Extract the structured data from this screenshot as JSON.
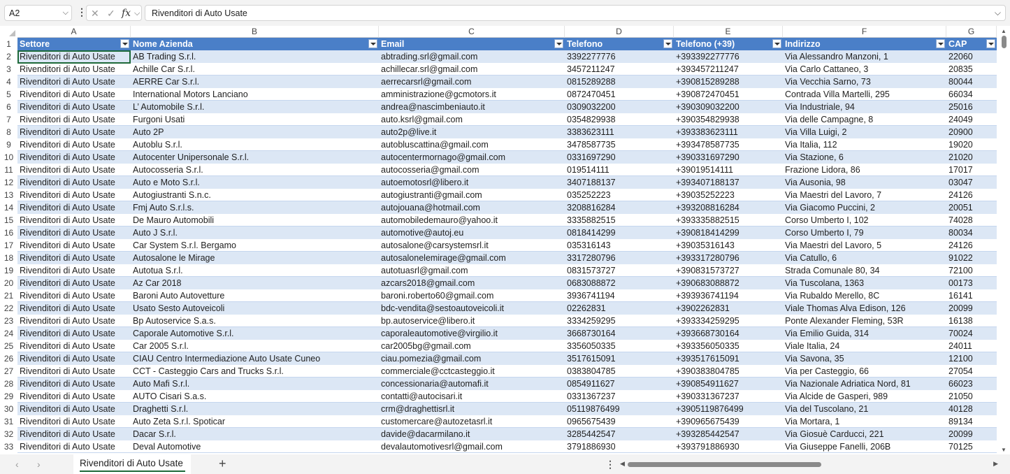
{
  "formula_bar": {
    "name_box": "A2",
    "cancel_icon": "✕",
    "enter_icon": "✓",
    "fx_label": "fx",
    "formula": "Rivenditori di Auto Usate"
  },
  "columns": [
    {
      "letter": "A",
      "header": "Settore"
    },
    {
      "letter": "B",
      "header": "Nome Azienda"
    },
    {
      "letter": "C",
      "header": "Email"
    },
    {
      "letter": "D",
      "header": "Telefono"
    },
    {
      "letter": "E",
      "header": "Telefono (+39)"
    },
    {
      "letter": "F",
      "header": "Indirizzo"
    },
    {
      "letter": "G",
      "header": "CAP"
    }
  ],
  "rows": [
    {
      "n": "2",
      "c": [
        "Rivenditori di Auto Usate",
        "AB Trading S.r.l.",
        "abtrading.srl@gmail.com",
        "3392277776",
        "+393392277776",
        "Via Alessandro Manzoni, 1",
        "22060"
      ]
    },
    {
      "n": "3",
      "c": [
        "Rivenditori di Auto Usate",
        "Achille Car S.r.l.",
        "achillecar.srl@gmail.com",
        "3457211247",
        "+393457211247",
        "Via Carlo Cattaneo, 3",
        "20835"
      ]
    },
    {
      "n": "4",
      "c": [
        "Rivenditori di Auto Usate",
        "AERRE Car S.r.l.",
        "aerrecarsrl@gmail.com",
        "0815289288",
        "+390815289288",
        "Via Vecchia Sarno, 73",
        "80044"
      ]
    },
    {
      "n": "5",
      "c": [
        "Rivenditori di Auto Usate",
        "International Motors Lanciano",
        "amministrazione@gcmotors.it",
        "0872470451",
        "+390872470451",
        "Contrada Villa Martelli, 295",
        "66034"
      ]
    },
    {
      "n": "6",
      "c": [
        "Rivenditori di Auto Usate",
        "L’ Automobile S.r.l.",
        "andrea@nascimbeniauto.it",
        "0309032200",
        "+390309032200",
        "Via Industriale, 94",
        "25016"
      ]
    },
    {
      "n": "7",
      "c": [
        "Rivenditori di Auto Usate",
        "Furgoni Usati",
        "auto.ksrl@gmail.com",
        "0354829938",
        "+390354829938",
        "Via delle Campagne, 8",
        "24049"
      ]
    },
    {
      "n": "8",
      "c": [
        "Rivenditori di Auto Usate",
        "Auto 2P",
        "auto2p@live.it",
        "3383623111",
        "+393383623111",
        "Via Villa Luigi, 2",
        "20900"
      ]
    },
    {
      "n": "9",
      "c": [
        "Rivenditori di Auto Usate",
        "Autoblu S.r.l.",
        "autobluscattina@gmail.com",
        "3478587735",
        "+393478587735",
        "Via Italia, 112",
        "19020"
      ]
    },
    {
      "n": "10",
      "c": [
        "Rivenditori di Auto Usate",
        "Autocenter Unipersonale S.r.l.",
        "autocentermornago@gmail.com",
        "0331697290",
        "+390331697290",
        "Via Stazione, 6",
        "21020"
      ]
    },
    {
      "n": "11",
      "c": [
        "Rivenditori di Auto Usate",
        "Autocosseria S.r.l.",
        "autocosseria@gmail.com",
        "019514111",
        "+39019514111",
        "Frazione Lidora, 86",
        "17017"
      ]
    },
    {
      "n": "12",
      "c": [
        "Rivenditori di Auto Usate",
        "Auto e Moto S.r.l.",
        "autoemotosrl@libero.it",
        "3407188137",
        "+393407188137",
        "Via Ausonia, 98",
        "03047"
      ]
    },
    {
      "n": "13",
      "c": [
        "Rivenditori di Auto Usate",
        "Autogiustranti S.n.c.",
        "autogiustranti@gmail.com",
        "035252223",
        "+39035252223",
        "Via Maestri del Lavoro, 7",
        "24126"
      ]
    },
    {
      "n": "14",
      "c": [
        "Rivenditori di Auto Usate",
        "Fmj Auto S.r.l.s.",
        "autojouana@hotmail.com",
        "3208816284",
        "+393208816284",
        "Via Giacomo Puccini, 2",
        "20051"
      ]
    },
    {
      "n": "15",
      "c": [
        "Rivenditori di Auto Usate",
        "De Mauro Automobili",
        "automobiledemauro@yahoo.it",
        "3335882515",
        "+393335882515",
        "Corso Umberto I, 102",
        "74028"
      ]
    },
    {
      "n": "16",
      "c": [
        "Rivenditori di Auto Usate",
        "Auto J S.r.l.",
        "automotive@autoj.eu",
        "0818414299",
        "+390818414299",
        "Corso Umberto I, 79",
        "80034"
      ]
    },
    {
      "n": "17",
      "c": [
        "Rivenditori di Auto Usate",
        "Car System S.r.l. Bergamo",
        "autosalone@carsystemsrl.it",
        "035316143",
        "+39035316143",
        "Via Maestri del Lavoro, 5",
        "24126"
      ]
    },
    {
      "n": "18",
      "c": [
        "Rivenditori di Auto Usate",
        "Autosalone le Mirage",
        "autosalonelemirage@gmail.com",
        "3317280796",
        "+393317280796",
        "Via Catullo, 6",
        "91022"
      ]
    },
    {
      "n": "19",
      "c": [
        "Rivenditori di Auto Usate",
        "Autotua S.r.l.",
        "autotuasrl@gmail.com",
        "0831573727",
        "+390831573727",
        "Strada Comunale 80, 34",
        "72100"
      ]
    },
    {
      "n": "20",
      "c": [
        "Rivenditori di Auto Usate",
        "Az Car 2018",
        "azcars2018@gmail.com",
        "0683088872",
        "+390683088872",
        "Via Tuscolana, 1363",
        "00173"
      ]
    },
    {
      "n": "21",
      "c": [
        "Rivenditori di Auto Usate",
        "Baroni Auto Autovetture",
        "baroni.roberto60@gmail.com",
        "3936741194",
        "+393936741194",
        "Via Rubaldo Merello, 8C",
        "16141"
      ]
    },
    {
      "n": "22",
      "c": [
        "Rivenditori di Auto Usate",
        "Usato Sesto Autoveicoli",
        "bdc-vendita@sestoautoveicoli.it",
        "02262831",
        "+3902262831",
        "Viale Thomas Alva Edison, 126",
        "20099"
      ]
    },
    {
      "n": "23",
      "c": [
        "Rivenditori di Auto Usate",
        "Bp Autoservice S.a.s.",
        "bp.autoservice@libero.it",
        "3334259295",
        "+393334259295",
        "Ponte Alexander Fleming, 53R",
        "16138"
      ]
    },
    {
      "n": "24",
      "c": [
        "Rivenditori di Auto Usate",
        "Caporale Automotive S.r.l.",
        "caporaleautomotive@virgilio.it",
        "3668730164",
        "+393668730164",
        "Via Emilio Guida, 314",
        "70024"
      ]
    },
    {
      "n": "25",
      "c": [
        "Rivenditori di Auto Usate",
        "Car 2005 S.r.l.",
        "car2005bg@gmail.com",
        "3356050335",
        "+393356050335",
        "Viale Italia, 24",
        "24011"
      ]
    },
    {
      "n": "26",
      "c": [
        "Rivenditori di Auto Usate",
        "CIAU Centro Intermediazione Auto Usate Cuneo",
        "ciau.pomezia@gmail.com",
        "3517615091",
        "+393517615091",
        "Via Savona, 35",
        "12100"
      ]
    },
    {
      "n": "27",
      "c": [
        "Rivenditori di Auto Usate",
        "CCT - Casteggio Cars and Trucks S.r.l.",
        "commerciale@cctcasteggio.it",
        "0383804785",
        "+390383804785",
        "Via per Casteggio, 66",
        "27054"
      ]
    },
    {
      "n": "28",
      "c": [
        "Rivenditori di Auto Usate",
        "Auto Mafi S.r.l.",
        "concessionaria@automafi.it",
        "0854911627",
        "+390854911627",
        "Via Nazionale Adriatica Nord, 81",
        "66023"
      ]
    },
    {
      "n": "29",
      "c": [
        "Rivenditori di Auto Usate",
        "AUTO Cisari S.a.s.",
        "contatti@autocisari.it",
        "0331367237",
        "+390331367237",
        "Via Alcide de Gasperi, 989",
        "21050"
      ]
    },
    {
      "n": "30",
      "c": [
        "Rivenditori di Auto Usate",
        "Draghetti S.r.l.",
        "crm@draghettisrl.it",
        "05119876499",
        "+3905119876499",
        "Via del Tuscolano, 21",
        "40128"
      ]
    },
    {
      "n": "31",
      "c": [
        "Rivenditori di Auto Usate",
        "Auto Zeta S.r.l. Spoticar",
        "customercare@autozetasrl.it",
        "0965675439",
        "+390965675439",
        "Via Mortara, 1",
        "89134"
      ]
    },
    {
      "n": "32",
      "c": [
        "Rivenditori di Auto Usate",
        "Dacar S.r.l.",
        "davide@dacarmilano.it",
        "3285442547",
        "+393285442547",
        "Via Giosuè Carducci, 221",
        "20099"
      ]
    },
    {
      "n": "33",
      "c": [
        "Rivenditori di Auto Usate",
        "Deval Automotive",
        "devalautomotivesrl@gmail.com",
        "3791886930",
        "+393791886930",
        "Via Giuseppe Fanelli, 206B",
        "70125"
      ]
    }
  ],
  "sheet_tab": "Rivenditori di Auto Usate",
  "colors": {
    "header_bg": "#4a7fc8",
    "band_bg": "#dce7f5",
    "selection": "#1e6a3a"
  }
}
